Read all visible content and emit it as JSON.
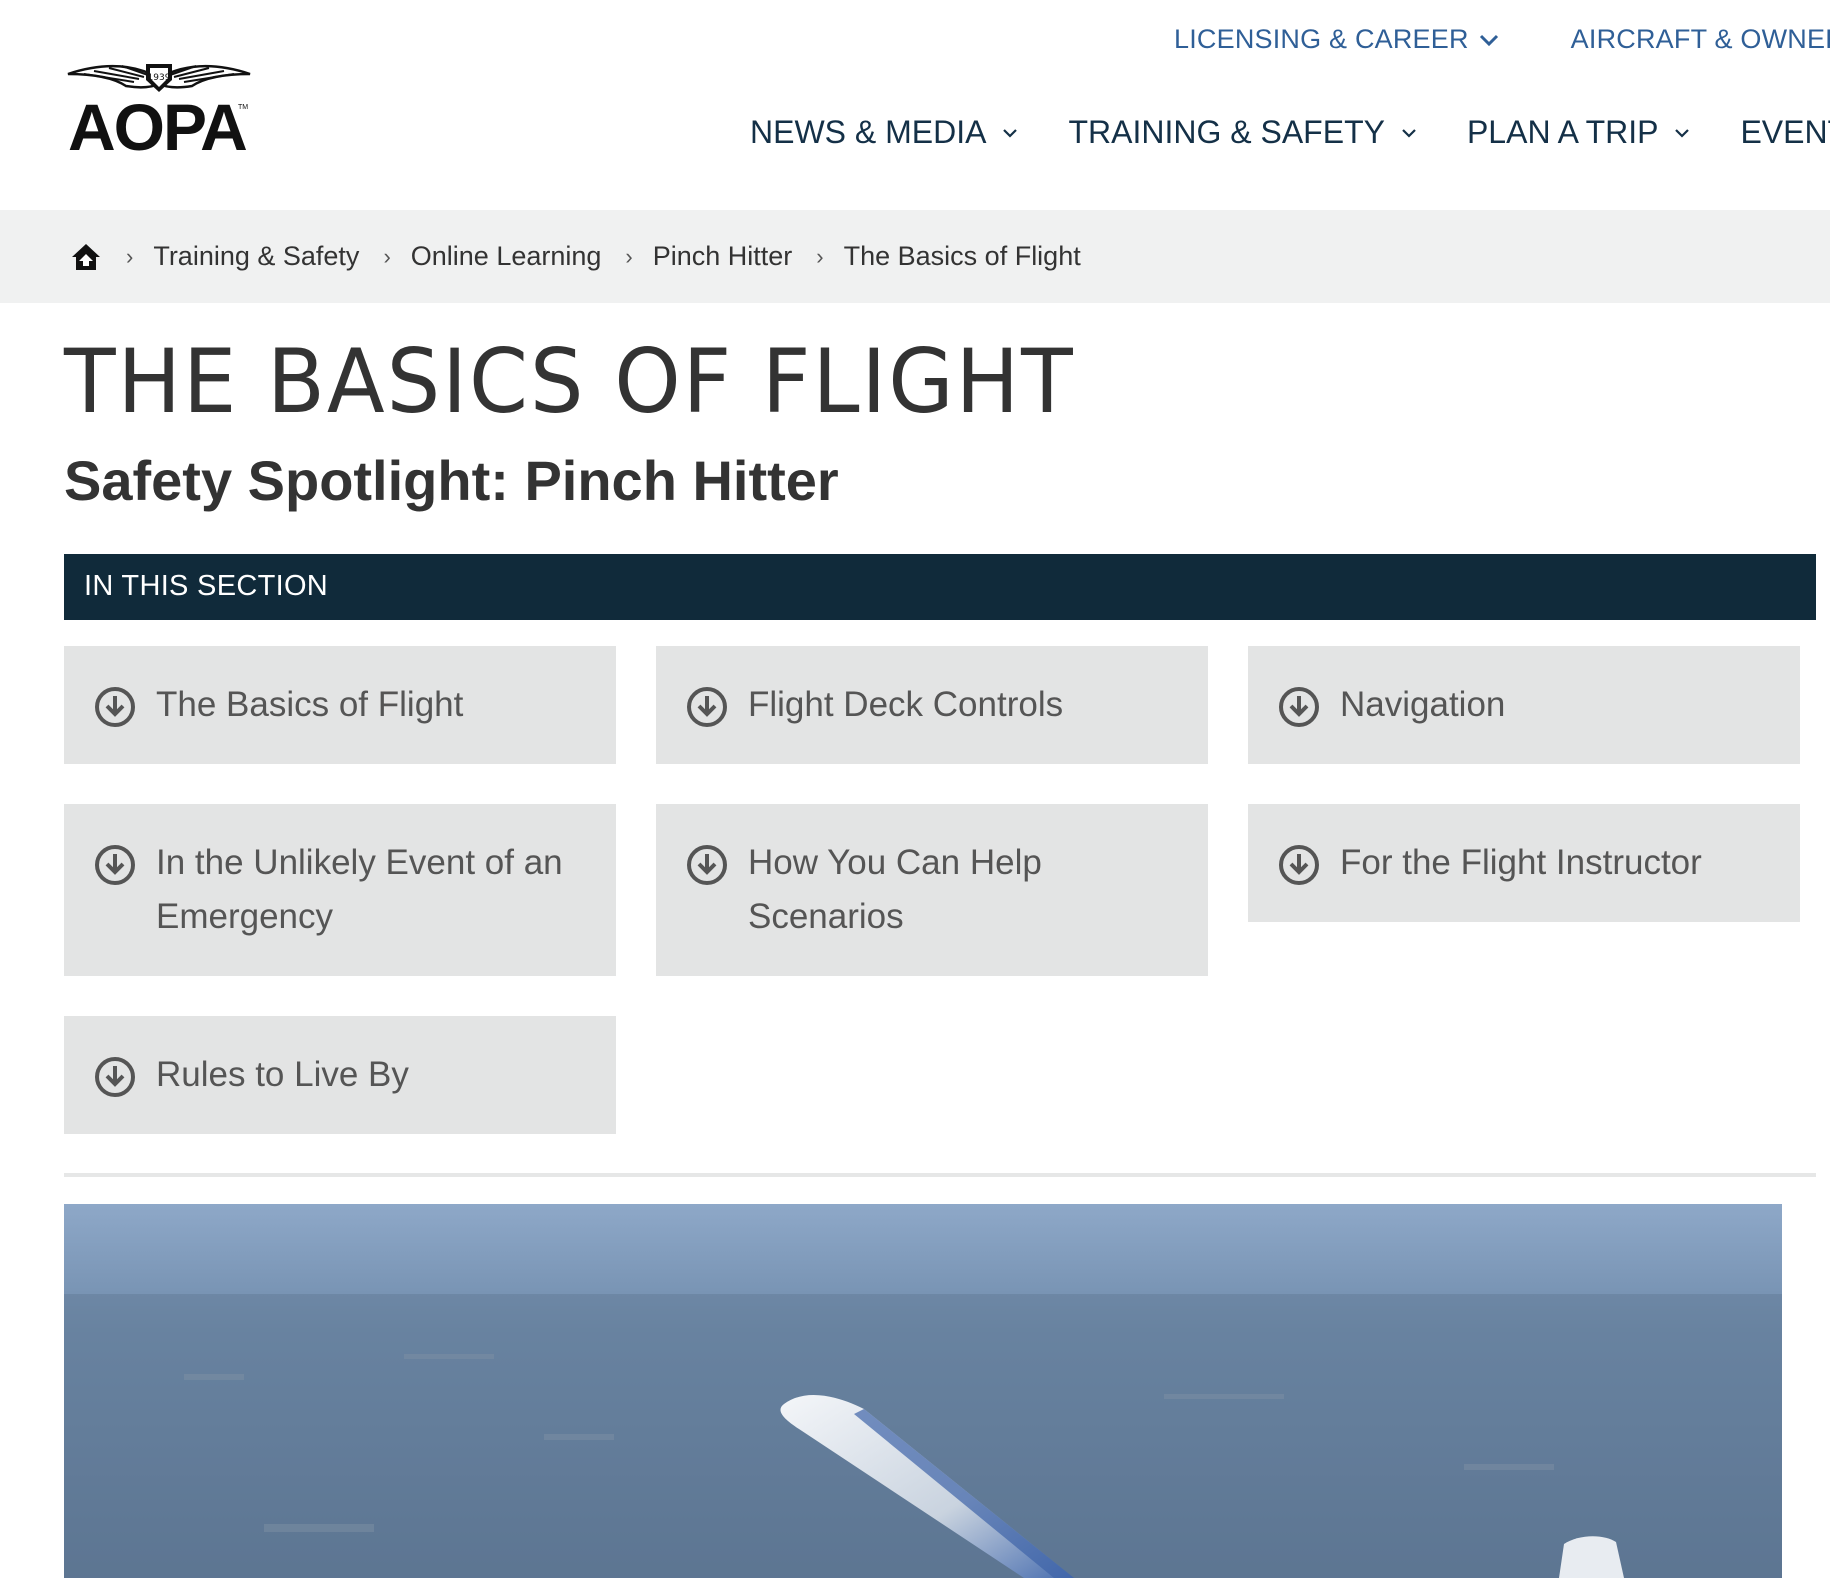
{
  "header": {
    "logo_text": "AOPA",
    "utility_nav": [
      {
        "label": "LICENSING & CAREER"
      },
      {
        "label": "AIRCRAFT & OWNERSHIP"
      }
    ],
    "main_nav": [
      {
        "label": "NEWS & MEDIA"
      },
      {
        "label": "TRAINING & SAFETY"
      },
      {
        "label": "PLAN A TRIP"
      },
      {
        "label": "EVENTS"
      }
    ]
  },
  "breadcrumb": {
    "items": [
      "Training & Safety",
      "Online Learning",
      "Pinch Hitter",
      "The Basics of Flight"
    ],
    "separator": "›"
  },
  "page": {
    "title": "THE BASICS OF FLIGHT",
    "subtitle": "Safety Spotlight: Pinch Hitter"
  },
  "section": {
    "heading": "IN THIS SECTION",
    "items": [
      {
        "label": "The Basics of Flight"
      },
      {
        "label": "Flight Deck Controls"
      },
      {
        "label": "Navigation"
      },
      {
        "label": "In the Unlikely Event of an Emergency"
      },
      {
        "label": "How You Can Help Scenarios"
      },
      {
        "label": "For the Flight Instructor"
      },
      {
        "label": "Rules to Live By"
      }
    ]
  },
  "colors": {
    "utility_nav": "#2f5f97",
    "main_nav": "#143047",
    "section_bar": "#102a3a",
    "card_bg": "#e3e4e4",
    "breadcrumb_bg": "#f0f1f1"
  },
  "icons": {
    "home": "home-icon",
    "chevron": "chevron-down-icon",
    "section_item": "arrow-down-circle-icon"
  }
}
